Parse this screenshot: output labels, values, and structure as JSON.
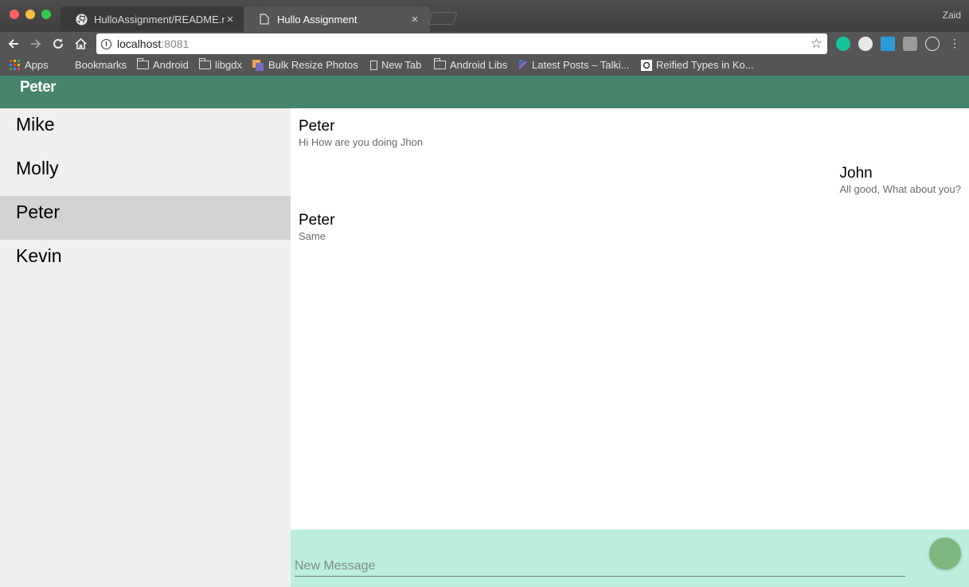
{
  "browser": {
    "tabs": [
      {
        "title": "HulloAssignment/README.md"
      },
      {
        "title": "Hullo Assignment"
      }
    ],
    "close_glyph": "×",
    "profile_name": "Zaid",
    "url_host": "localhost",
    "url_port": ":8081",
    "star_glyph": "☆",
    "bookmarks": {
      "apps": "Apps",
      "bookmarks": "Bookmarks",
      "android": "Android",
      "libgdx": "libgdx",
      "bulk_resize": "Bulk Resize Photos",
      "new_tab": "New Tab",
      "android_libs": "Android Libs",
      "latest_posts": "Latest Posts – Talki...",
      "reified": "Reified Types in Ko..."
    }
  },
  "app": {
    "title": "Peter",
    "contacts": [
      {
        "name": "Mike"
      },
      {
        "name": "Molly"
      },
      {
        "name": "Peter"
      },
      {
        "name": "Kevin"
      }
    ],
    "messages": [
      {
        "sender": "Peter",
        "text": "Hi How are you doing Jhon"
      },
      {
        "sender": "John",
        "text": "All good, What about you?"
      },
      {
        "sender": "Peter",
        "text": "Same"
      }
    ],
    "composer": {
      "placeholder": "New Message"
    }
  },
  "colors": {
    "header": "#46846b",
    "composer_bg": "#bbeedc",
    "send_button": "#7cb77f",
    "active_contact": "#d3d3d3"
  }
}
